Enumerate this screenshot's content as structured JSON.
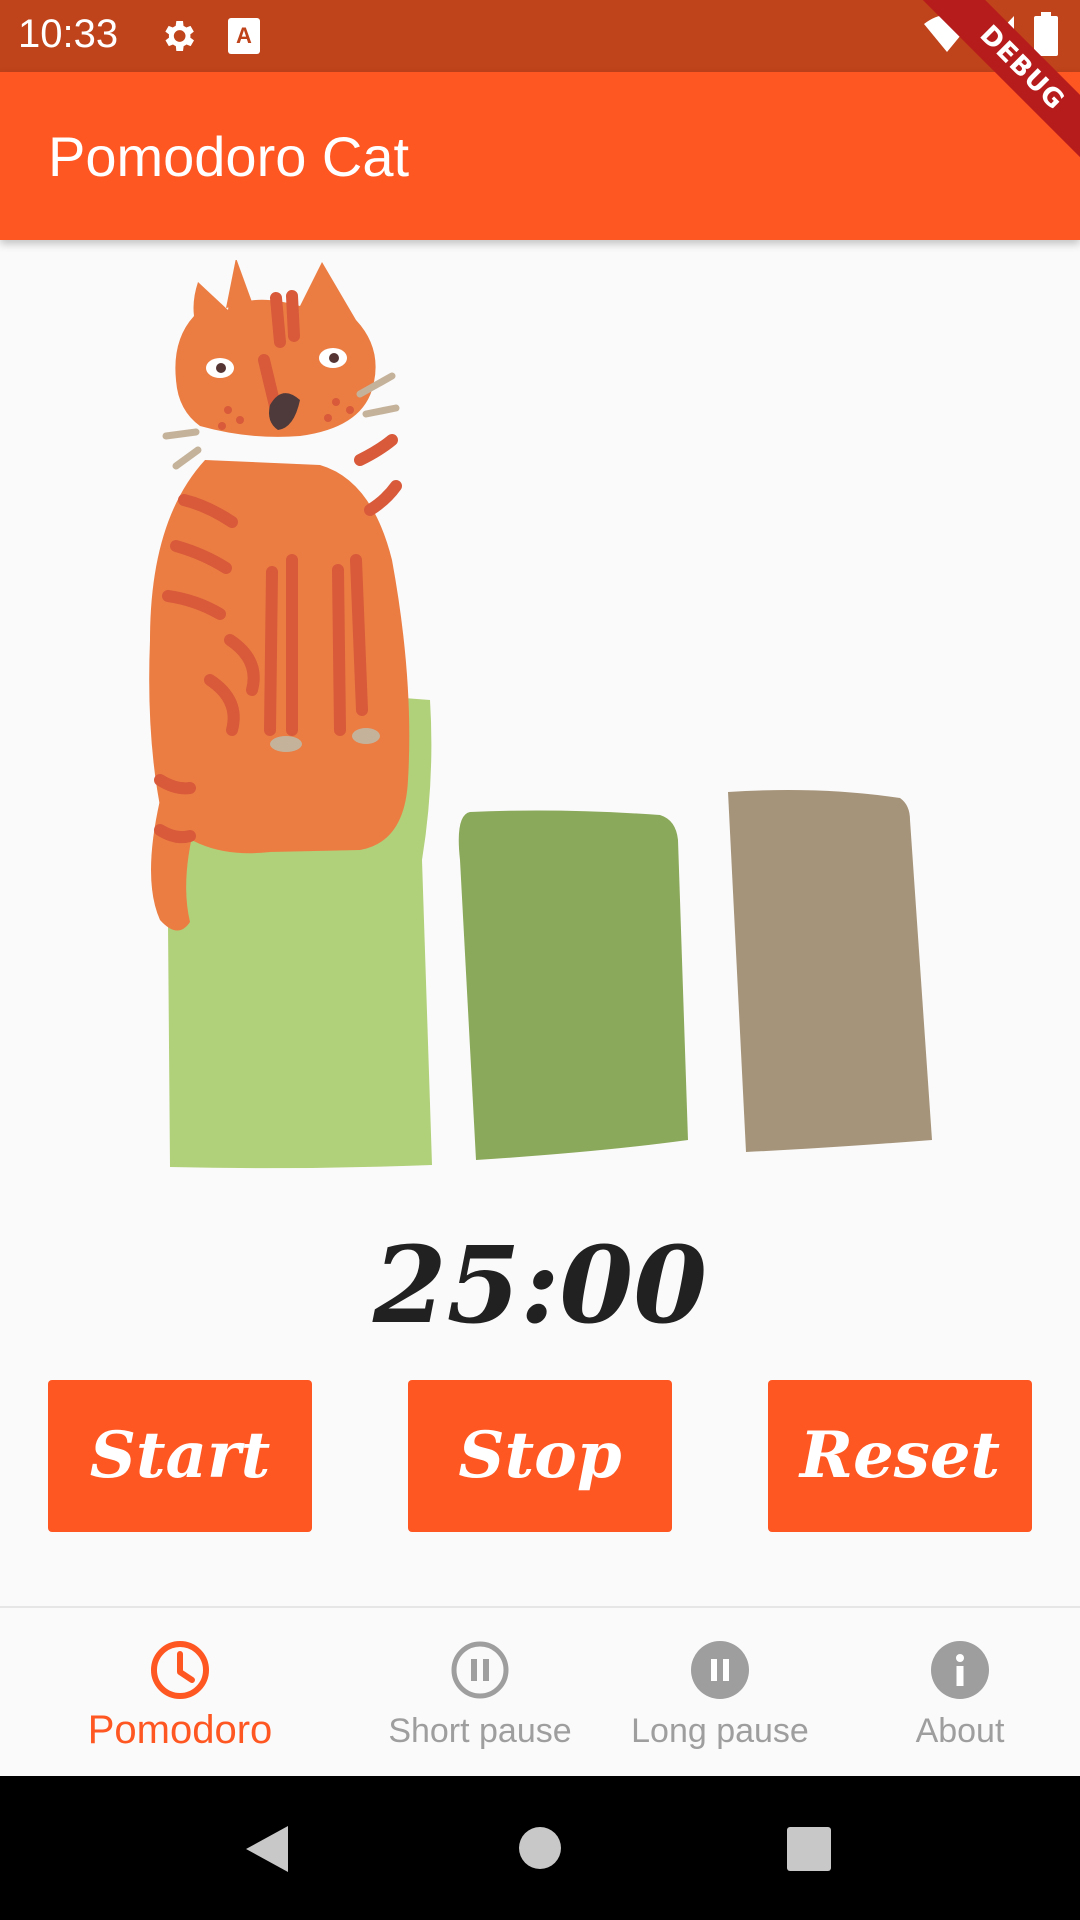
{
  "status_bar": {
    "time": "10:33",
    "icons": [
      "settings-icon",
      "text-a-icon",
      "wifi-icon",
      "signal-icon",
      "battery-icon"
    ]
  },
  "debug_banner": "DEBUG",
  "app_bar": {
    "title": "Pomodoro Cat"
  },
  "timer": {
    "value": "25:00"
  },
  "buttons": {
    "start": "Start",
    "stop": "Stop",
    "reset": "Reset"
  },
  "bottom_nav": {
    "items": [
      {
        "label": "Pomodoro",
        "icon": "clock-icon",
        "active": true
      },
      {
        "label": "Short pause",
        "icon": "pause-outline-icon",
        "active": false
      },
      {
        "label": "Long pause",
        "icon": "pause-filled-icon",
        "active": false
      },
      {
        "label": "About",
        "icon": "info-icon",
        "active": false
      }
    ]
  },
  "system_nav": {
    "icons": [
      "back-icon",
      "home-icon",
      "recents-icon"
    ]
  },
  "colors": {
    "primary": "#FF5722",
    "status_bar": "#BF431B",
    "block_light_green": "#B1D07A",
    "block_green": "#8BA95A",
    "block_taupe": "#A6947A",
    "cat_orange": "#EB7D43"
  }
}
